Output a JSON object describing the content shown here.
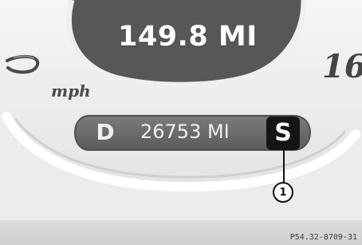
{
  "display": {
    "speed_readout": "149.8 MI",
    "speed_unit": "mph",
    "scale_number": "16",
    "gear": "D",
    "odometer": "26753 MI",
    "mode": "S",
    "callout_number": "1",
    "image_code": "P54.32-8709-31"
  },
  "theme": {
    "dial_dark": "#575757",
    "display_panel": "#6a6a6a",
    "dial_rim": "#f3f3f3",
    "mode_box": "#151515"
  }
}
